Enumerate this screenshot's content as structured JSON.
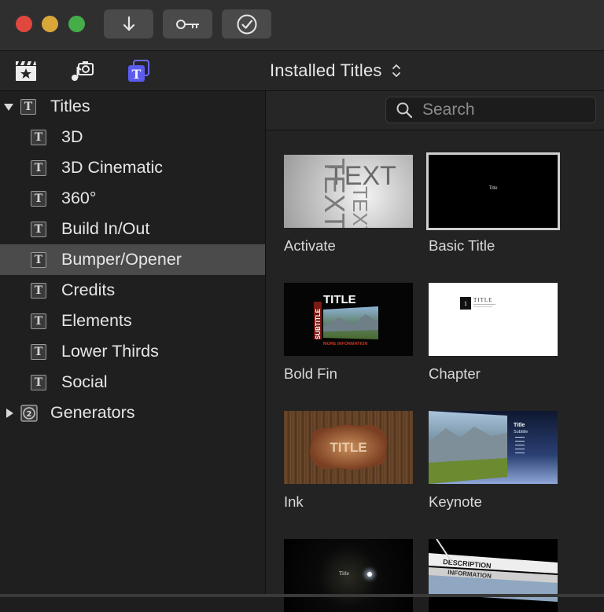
{
  "window": {
    "traffic_lights": {
      "close_color": "#e0473f",
      "minimize_color": "#d9a63a",
      "zoom_color": "#45ac4a"
    },
    "toolbar_buttons": [
      "download-icon",
      "key-icon",
      "checkmark-circle-icon"
    ]
  },
  "browser": {
    "tabs": [
      {
        "name": "photos-and-video",
        "icon": "clapper-star-icon"
      },
      {
        "name": "music-and-sound",
        "icon": "music-camera-icon"
      },
      {
        "name": "titles-and-generators",
        "icon": "titles-generators-icon",
        "active_color": "#5b5bf0"
      }
    ],
    "filter_label": "Installed Titles",
    "search": {
      "placeholder": "Search",
      "value": ""
    }
  },
  "sidebar": {
    "categories": [
      {
        "label": "Titles",
        "expanded": true
      },
      {
        "label": "Generators",
        "expanded": false
      }
    ],
    "title_items": [
      {
        "label": "3D"
      },
      {
        "label": "3D Cinematic"
      },
      {
        "label": "360°"
      },
      {
        "label": "Build In/Out"
      },
      {
        "label": "Bumper/Opener",
        "selected": true
      },
      {
        "label": "Credits"
      },
      {
        "label": "Elements"
      },
      {
        "label": "Lower Thirds"
      },
      {
        "label": "Social"
      }
    ],
    "generator_icon_text": "2"
  },
  "grid": {
    "items": [
      {
        "name": "Activate",
        "thumb_text": "TEXT"
      },
      {
        "name": "Basic Title",
        "thumb_text": "Title",
        "selected": true
      },
      {
        "name": "Bold Fin",
        "thumb_text": "TITLE",
        "thumb_subtitle": "SUBTITLE",
        "thumb_info": "MORE INFORMATION"
      },
      {
        "name": "Chapter",
        "thumb_text": "TITLE",
        "thumb_number": "1"
      },
      {
        "name": "Ink",
        "thumb_text": "TITLE"
      },
      {
        "name": "Keynote",
        "thumb_text": "Title",
        "thumb_subtitle": "Subtitle"
      },
      {
        "name": "",
        "thumb_text": "Title"
      },
      {
        "name": "",
        "thumb_text": "DESCRIPTION",
        "thumb_info": "INFORMATION"
      }
    ]
  }
}
